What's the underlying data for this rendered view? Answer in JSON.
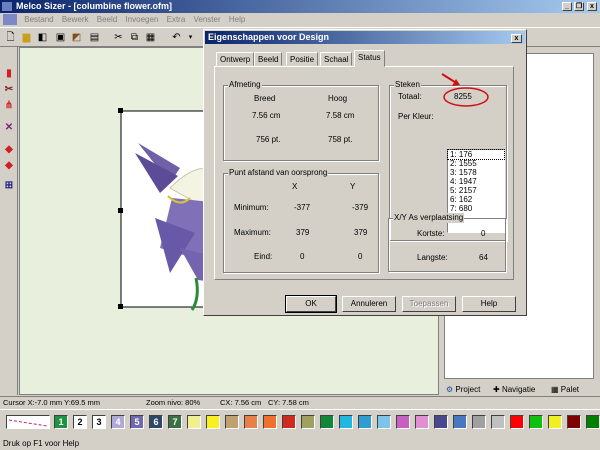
{
  "app": {
    "title": "Melco Sizer - [columbine flower.ofm]",
    "minimize_glyph": "_",
    "restore_glyph": "❐",
    "close_glyph": "x"
  },
  "menu": {
    "items": [
      {
        "label": "Bestand"
      },
      {
        "label": "Bewerk"
      },
      {
        "label": "Beeld"
      },
      {
        "label": "Invoegen"
      },
      {
        "label": "Extra"
      },
      {
        "label": "Venster"
      },
      {
        "label": "Help"
      }
    ]
  },
  "dialog": {
    "title": "Eigenschappen voor Design",
    "close_glyph": "x",
    "tabs": [
      {
        "label": "Ontwerp"
      },
      {
        "label": "Beeld"
      },
      {
        "label": "Positie"
      },
      {
        "label": "Schaal"
      },
      {
        "label": "Status"
      }
    ],
    "afmeting": {
      "title": "Afmeting",
      "col_width": "Breed",
      "col_height": "Hoog",
      "width_cm": "7.56 cm",
      "height_cm": "7.58 cm",
      "width_pt": "756 pt.",
      "height_pt": "758 pt."
    },
    "punt": {
      "title": "Punt afstand van oorsprong",
      "col_x": "X",
      "col_y": "Y",
      "min_label": "Minimum:",
      "min_x": "-377",
      "min_y": "-379",
      "max_label": "Maximum:",
      "max_x": "379",
      "max_y": "379",
      "end_label": "Eind:",
      "end_x": "0",
      "end_y": "0"
    },
    "steken": {
      "title": "Steken",
      "total_label": "Totaal:",
      "total_value": "8255",
      "per_color_label": "Per Kleur:",
      "per_color": [
        "1: 176",
        "2: 1555",
        "3: 1578",
        "4: 1947",
        "5: 2157",
        "6: 162",
        "7: 680"
      ]
    },
    "xy": {
      "title": "X/Y As verplaatsing",
      "shortest_label": "Kortste:",
      "shortest_value": "0",
      "longest_label": "Langste:",
      "longest_value": "64"
    },
    "buttons": {
      "ok": "OK",
      "cancel": "Annuleren",
      "apply": "Toepassen",
      "help": "Help"
    }
  },
  "right_panel": {
    "tabs": [
      {
        "label": "Project"
      },
      {
        "label": "Navigatie"
      },
      {
        "label": "Palet"
      }
    ]
  },
  "status": {
    "cursor": "Cursor X:-7.0 mm Y:69.5 mm",
    "zoom": "Zoom nivo: 80%",
    "cx": "CX: 7.56 cm",
    "cy": "CY: 7.58 cm",
    "help_text": "Druk op F1 voor Help"
  },
  "palette": {
    "numbered": [
      {
        "label": "1",
        "color": "#1e9440"
      },
      {
        "label": "2",
        "color": "#ffffff"
      },
      {
        "label": "3",
        "color": "#ffffff"
      },
      {
        "label": "4",
        "color": "#b0a8d8"
      },
      {
        "label": "5",
        "color": "#7068b0"
      },
      {
        "label": "6",
        "color": "#304868"
      },
      {
        "label": "7",
        "color": "#3c7040"
      }
    ],
    "colors": [
      "#f0f090",
      "#f8f020",
      "#c0a070",
      "#e8804a",
      "#f07030",
      "#d02a20",
      "#a0a060",
      "#108838",
      "#20b8e0",
      "#309cd0",
      "#7cc4e8",
      "#c860c0",
      "#e090d0",
      "#484890",
      "#4878c0",
      "#a0a0a0",
      "#c0c0c0",
      "#ff0000",
      "#10c010",
      "#f0f020",
      "#800000",
      "#008000",
      "#8000ff"
    ]
  }
}
